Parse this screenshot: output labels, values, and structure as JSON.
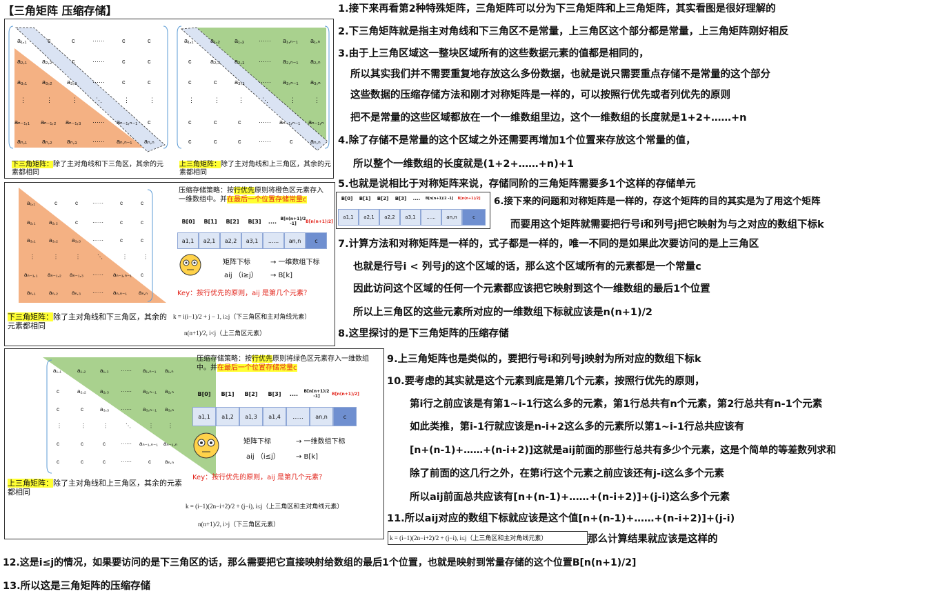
{
  "title": "【三角矩阵 压缩存储】",
  "panel1": {
    "caption_hl": "下三角矩阵：",
    "caption_rest": "除了主对角线和下三角区，其余的元素都相同"
  },
  "panel2": {
    "caption_hl": "上三角矩阵：",
    "caption_rest": "除了主对角线和上三角区，其余的元素都相同"
  },
  "panel3": {
    "strategy_a": "压缩存储策略：按",
    "strategy_hl": "行优先",
    "strategy_b": "原则将橙色区元素存入一维数组中。并",
    "strategy_hl2": "在最后一个位置存储常量c",
    "headers": [
      "B[0]",
      "B[1]",
      "B[2]",
      "B[3]",
      "....",
      "B[n(n+1)/2 -1]",
      "B[n(n+1)/2]"
    ],
    "cells": [
      "a1,1",
      "a2,1",
      "a2,2",
      "a3,1",
      "......",
      "an,n",
      "c"
    ],
    "map1_a": "矩阵下标",
    "map1_b": "→ 一维数组下标",
    "map2_a": "aij （i≥j）",
    "map2_b": "→    B[k]",
    "key": "Key：按行优先的原则，aij 是第几个元素？",
    "caption_hl": "下三角矩阵：",
    "caption_rest": "除了主对角线和下三角区，其余的元素都相同",
    "formula1": "k = i(i−1)/2 + j − 1,      i≥j（下三角区和主对角线元素）",
    "formula2": "n(n+1)/2,                      i<j（上三角区元素）"
  },
  "panel4": {
    "strategy_a": "压缩存储策略：按",
    "strategy_hl": "行优先",
    "strategy_b": "原则将绿色区元素存入一维数组中。并",
    "strategy_hl2": "在最后一个位置存储常量c",
    "headers": [
      "B[0]",
      "B[1]",
      "B[2]",
      "B[3]",
      "....",
      "B[n(n+1)/2 -1]",
      "B[n(n+1)/2]"
    ],
    "cells": [
      "a1,1",
      "a1,2",
      "a1,3",
      "a1,4",
      "......",
      "an,n",
      "c"
    ],
    "map1_a": "矩阵下标",
    "map1_b": "→ 一维数组下标",
    "map2_a": "aij （i≤j）",
    "map2_b": "→    B[k]",
    "key": "Key：按行优先的原则，aij 是第几个元素？",
    "caption_hl": "上三角矩阵：",
    "caption_rest": "除了主对角线和上三角区，其余的元素都相同",
    "formula1": "k = (i−1)(2n−i+2)/2 + (j−i),   i≤j（上三角区和主对角线元素）",
    "formula2": "n(n+1)/2,                           i>j（下三角区元素）"
  },
  "lines": {
    "l1": "1.接下来再看第2种特殊矩阵，三角矩阵可以分为下三角矩阵和上三角矩阵，其实看图是很好理解的",
    "l2": "2.下三角矩阵就是指主对角线和下三角区不是常量，上三角区这个部分都是常量，上三角矩阵刚好相反",
    "l3": "3.由于上三角区域这一整块区域所有的这些数据元素的值都是相同的，",
    "l3b": "所以其实我们并不需要重复地存放这么多份数据，也就是说只需要重点存储不是常量的这个部分",
    "l3c": "这些数据的压缩存储方法和刚才对称矩阵是一样的，可以按照行优先或者列优先的原则",
    "l3d": "把不是常量的这些区域都放在一个一维数组里边，这个一维数组的长度就是1+2+……+n",
    "l4": "4.除了存储不是常量的这个区域之外还需要再增加1个位置来存放这个常量的值，",
    "l4b": "所以整个一维数组的长度就是(1+2+……+n)+1",
    "l5": "5.也就是说相比于对称矩阵来说，存储同阶的三角矩阵需要多1个这样的存储单元",
    "l6": "6.接下来的问题和对称矩阵是一样的，存这个矩阵的目的其实是为了用这个矩阵",
    "l6b": "而要用这个矩阵就需要把行号i和列号j把它映射为与之对应的数组下标k",
    "l7": "7.计算方法和对称矩阵是一样的，式子都是一样的，唯一不同的是如果此次要访问的是上三角区",
    "l7b": "也就是行号i < 列号j的这个区域的话，那么这个区域所有的元素都是一个常量c",
    "l7c": "因此访问这个区域的任何一个元素都应该把它映射到这个一维数组的最后1个位置",
    "l7d": "所以上三角区的这些元素所对应的一维数组下标就应该是n(n+1)/2",
    "l8": "8.这里探讨的是下三角矩阵的压缩存储",
    "l9": "9.上三角矩阵也是类似的，要把行号i和列号j映射为所对应的数组下标k",
    "l10": "10.要考虑的其实就是这个元素到底是第几个元素，按照行优先的原则，",
    "l10b": "第i行之前应该是有第1~i-1行这么多的元素，第1行总共有n个元素，第2行总共有n-1个元素",
    "l10c": "如此类推，第i-1行就应该是n-i+2这么多的元素所以第1~i-1行总共应该有",
    "l10d": "[n+(n-1)+……+(n-i+2)]这就是aij前面的那些行总共有多少个元素，这是个简单的等差数列求和",
    "l10e": "除了前面的这几行之外，在第i行这个元素之前应该还有j-i这么多个元素",
    "l10f": "所以aij前面总共应该有[n+(n-1)+……+(n-i+2)]+(j-i)这么多个元素",
    "l11": "11.所以aij对应的数组下标就应该是这个值[n+(n-1)+……+(n-i+2)]+(j-i)",
    "l11b": "那么计算结果就应该是这样的",
    "l11formula": "k = (i−1)(2n−i+2)/2 + (j−i),   i≤j（上三角区和主对角线元素）",
    "l12": "12.这是i≤j的情况，如果要访问的是下三角区的话，那么需要把它直接映射给数组的最后1个位置，也就是映射到常量存储的这个位置B[n(n+1)/2]",
    "l13": "13.所以这是三角矩阵的压缩存储"
  },
  "mini_array": {
    "headers": [
      "B[0]",
      "B[1]",
      "B[2]",
      "B[3]",
      "....",
      "B[n(n+1)/2 -1]",
      "B[n(n+1)/2]"
    ],
    "cells": [
      "a1,1",
      "a2,1",
      "a2,2",
      "a3,1",
      "......",
      "an,n",
      "c"
    ]
  },
  "colors": {
    "orange": "#f4b183",
    "green": "#a9d18e",
    "blue_diag": "#dae3f3",
    "red": "#e2231a",
    "blue": "#1f3fd6"
  }
}
